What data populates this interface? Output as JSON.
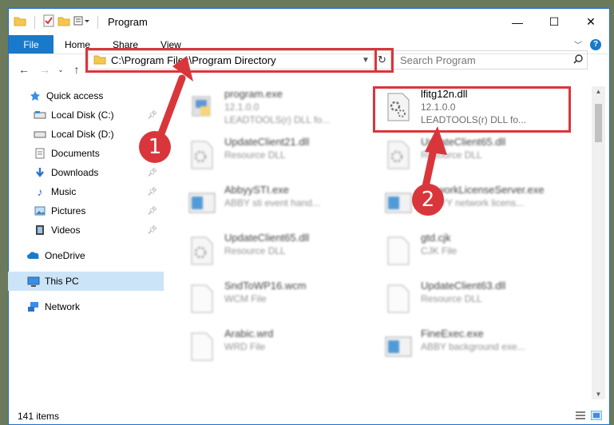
{
  "titlebar": {
    "title": "Program"
  },
  "ribbon": {
    "tabs": [
      "File",
      "Home",
      "Share",
      "View"
    ],
    "help": "?"
  },
  "nav": {
    "address": "C:\\Program Files\\Program Directory",
    "search_placeholder": "Search Program"
  },
  "sidebar": {
    "items": [
      {
        "label": "Quick access",
        "pinned": false
      },
      {
        "label": "Local Disk (C:)",
        "pinned": true
      },
      {
        "label": "Local Disk (D:)",
        "pinned": false
      },
      {
        "label": "Documents",
        "pinned": true
      },
      {
        "label": "Downloads",
        "pinned": true
      },
      {
        "label": "Music",
        "pinned": true
      },
      {
        "label": "Pictures",
        "pinned": true
      },
      {
        "label": "Videos",
        "pinned": true
      },
      {
        "label": "OneDrive"
      },
      {
        "label": "This PC"
      },
      {
        "label": "Network"
      }
    ]
  },
  "files": [
    {
      "name": "program.exe",
      "line2": "12.1.0.0",
      "line3": "LEADTOOLS(r) DLL fo..."
    },
    {
      "name": "lfitg12n.dll",
      "line2": "12.1.0.0",
      "line3": "LEADTOOLS(r) DLL fo..."
    },
    {
      "name": "UpdateClient21.dll",
      "line2": "Resource DLL",
      "line3": ""
    },
    {
      "name": "UpdateClient65.dll",
      "line2": "Resource DLL",
      "line3": ""
    },
    {
      "name": "AbbyySTI.exe",
      "line2": "ABBY sti event hand...",
      "line3": ""
    },
    {
      "name": "NetworkLicenseServer.exe",
      "line2": "ABBYY network licens...",
      "line3": ""
    },
    {
      "name": "UpdateClient65.dll",
      "line2": "Resource DLL",
      "line3": ""
    },
    {
      "name": "gtd.cjk",
      "line2": "CJK File",
      "line3": ""
    },
    {
      "name": "SndToWP16.wcm",
      "line2": "WCM File",
      "line3": ""
    },
    {
      "name": "UpdateClient63.dll",
      "line2": "Resource DLL",
      "line3": ""
    },
    {
      "name": "Arabic.wrd",
      "line2": "WRD File",
      "line3": ""
    },
    {
      "name": "FineExec.exe",
      "line2": "ABBY background exe...",
      "line3": ""
    }
  ],
  "status": {
    "count": "141 items"
  },
  "markers": [
    "1",
    "2"
  ],
  "colors": {
    "accent": "#1979ca",
    "highlight": "#d9363b",
    "selected": "#cce4f7"
  }
}
